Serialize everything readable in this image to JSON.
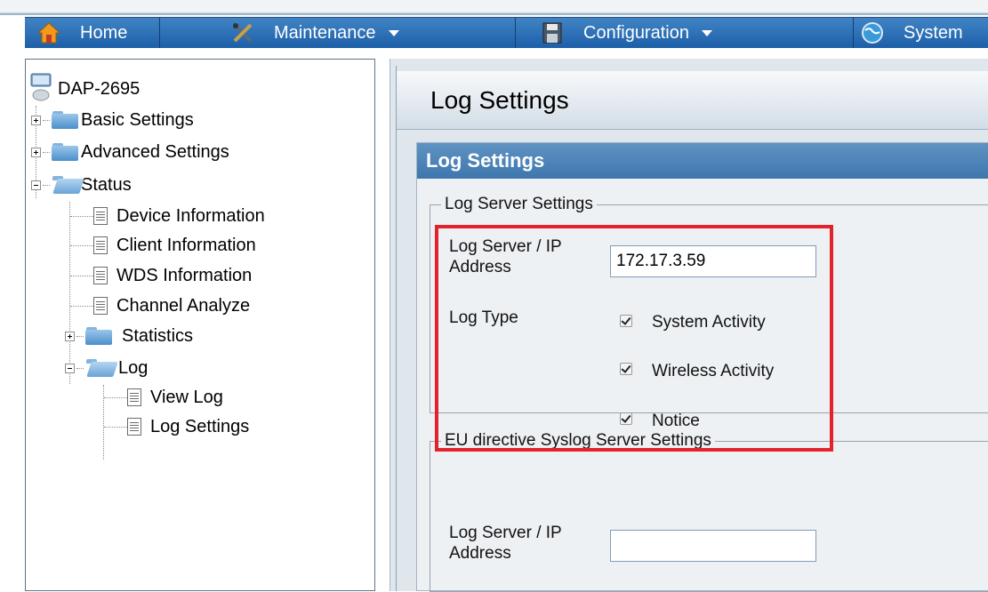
{
  "nav": {
    "items": [
      {
        "label": "Home",
        "icon": "home-icon",
        "caret": false
      },
      {
        "label": "Maintenance",
        "icon": "tools-icon",
        "caret": true
      },
      {
        "label": "Configuration",
        "icon": "floppy-disk-icon",
        "caret": true
      },
      {
        "label": "System",
        "icon": "globe-icon",
        "caret": false
      }
    ]
  },
  "tree": {
    "root": "DAP-2695",
    "basic_settings": "Basic Settings",
    "advanced_settings": "Advanced Settings",
    "status": "Status",
    "device_information": "Device Information",
    "client_information": "Client Information",
    "wds_information": "WDS Information",
    "channel_analyze": "Channel Analyze",
    "statistics": "Statistics",
    "log": "Log",
    "view_log": "View Log",
    "log_settings": "Log Settings"
  },
  "page": {
    "title": "Log Settings",
    "section_title": "Log Settings",
    "log_server": {
      "legend": "Log Server Settings",
      "address_label_line1": "Log Server / IP",
      "address_label_line2": "Address",
      "address_value": "172.17.3.59",
      "log_type_label": "Log Type",
      "system_activity": "System Activity",
      "wireless_activity": "Wireless Activity",
      "notice": "Notice"
    },
    "eu_syslog": {
      "legend": "EU directive Syslog Server Settings",
      "address_label_line1": "Log Server / IP",
      "address_label_line2": "Address",
      "address_value": ""
    }
  },
  "colors": {
    "nav_bar": "#2b6db4",
    "section_header": "#4a80b6",
    "highlight": "#e3232b"
  }
}
